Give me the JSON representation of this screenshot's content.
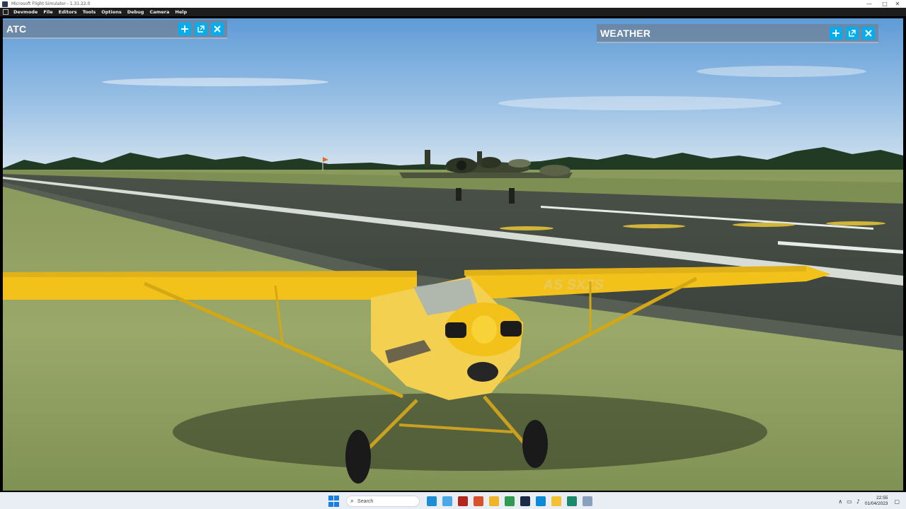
{
  "window": {
    "title": "Microsoft Flight Simulator - 1.31.22.0",
    "min_glyph": "—",
    "max_glyph": "□",
    "close_glyph": "✕"
  },
  "devmenu": {
    "items": [
      "Devmode",
      "File",
      "Editors",
      "Tools",
      "Options",
      "Debug",
      "Camera",
      "Help"
    ]
  },
  "panels": {
    "atc": {
      "title": "ATC"
    },
    "weather": {
      "title": "WEATHER"
    }
  },
  "aircraft": {
    "registration": "AS SXZS"
  },
  "taskbar": {
    "search_label": "Search",
    "search_icon": "search-icon",
    "tray_up_glyph": "∧",
    "time": "22:55",
    "date": "01/04/2023",
    "apps": [
      {
        "name": "edge-browser-icon",
        "color": "#1f8dd6"
      },
      {
        "name": "photos-icon",
        "color": "#4aa8e8"
      },
      {
        "name": "flight-sim-app-icon",
        "color": "#b3261e"
      },
      {
        "name": "office-icon",
        "color": "#d9502b"
      },
      {
        "name": "file-manager-icon",
        "color": "#f0b428"
      },
      {
        "name": "gallery-icon",
        "color": "#2e9b4f"
      },
      {
        "name": "terminal-icon",
        "color": "#1b2a47"
      },
      {
        "name": "edge-icon",
        "color": "#0d8ad6"
      },
      {
        "name": "folder-icon",
        "color": "#f2c233"
      },
      {
        "name": "app-icon",
        "color": "#1a8a6a"
      },
      {
        "name": "settings-icon",
        "color": "#8aa1bd"
      }
    ]
  },
  "colors": {
    "accent": "#00aef0",
    "panel": "#6e8096",
    "plane_yellow": "#f2c21b"
  }
}
